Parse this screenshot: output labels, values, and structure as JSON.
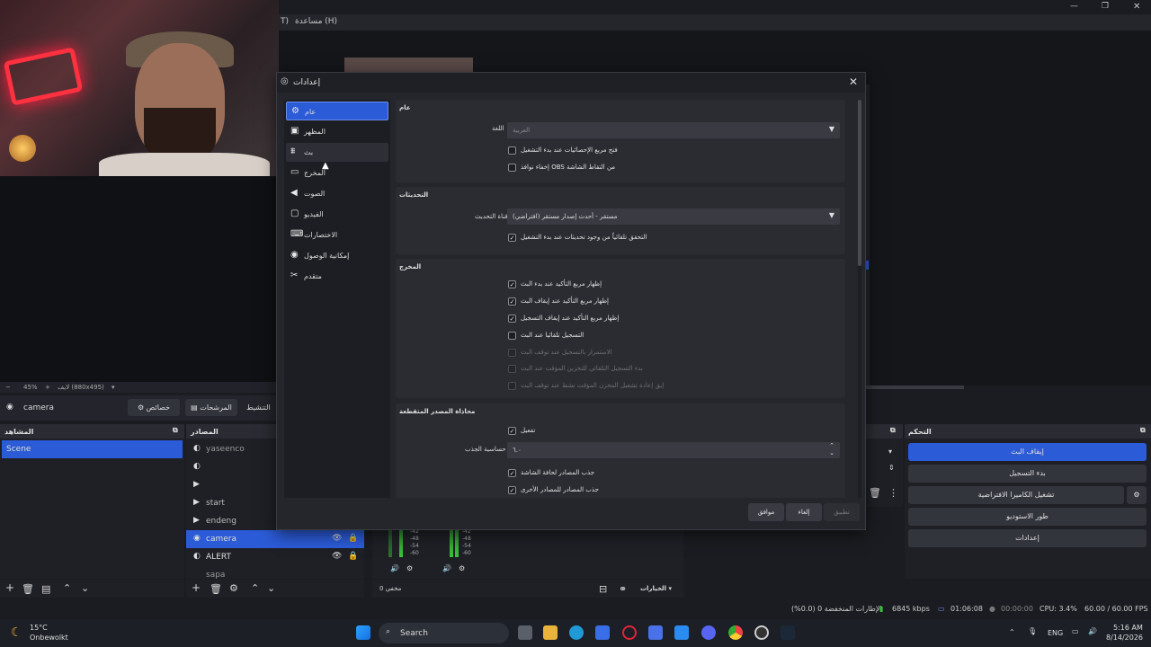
{
  "obs": {
    "menubar": {
      "help": "مساعدة (H)",
      "t": "T)"
    },
    "zoom": {
      "percent": "45%",
      "size": "لايف (880x495)"
    },
    "scene_toolbar": {
      "camera_label": "camera",
      "properties": "خصائص",
      "filters": "المرشحات",
      "activate": "التنشيط"
    },
    "scenes": {
      "title": "المشاهد",
      "items": [
        "Scene"
      ]
    },
    "sources": {
      "title": "المصادر",
      "items": [
        "yaseenco",
        "",
        "",
        "start",
        "endeng",
        "camera",
        "ALERT",
        "sapa"
      ]
    },
    "controls": {
      "title": "التحكم",
      "buttons": [
        "إيقاف البث",
        "بدء التسجيل",
        "تشغيل الكاميرا الافتراضية",
        "طور الاستوديو",
        "إعدادات"
      ]
    },
    "mixer": {
      "ticks": [
        "-42",
        "-48",
        "-54",
        "-60"
      ],
      "muted_label": "مخفي 0",
      "options": "الخيارات"
    },
    "status": {
      "dropped": "الإطارات المنخفضة 0 (0.0%)",
      "kbps": "6845 kbps",
      "stream_time": "01:06:08",
      "rec_time": "00:00:00",
      "cpu": "CPU: 3.4%",
      "fps": "60.00 / 60.00 FPS"
    }
  },
  "taskbar": {
    "weather_temp": "15°C",
    "weather_desc": "Onbewolkt",
    "search_placeholder": "Search",
    "lang": "ENG",
    "time": "5:16 AM",
    "date": "8/14/2026"
  },
  "dialog": {
    "title": "إعدادات",
    "nav": [
      {
        "label": "عام",
        "icon": "gear-icon"
      },
      {
        "label": "المظهر",
        "icon": "appearance-icon"
      },
      {
        "label": "بث",
        "icon": "stream-icon"
      },
      {
        "label": "المخرج",
        "icon": "output-icon"
      },
      {
        "label": "الصوت",
        "icon": "audio-icon"
      },
      {
        "label": "الفيديو",
        "icon": "video-icon"
      },
      {
        "label": "الاختصارات",
        "icon": "keyboard-icon"
      },
      {
        "label": "إمكانية الوصول",
        "icon": "accessibility-icon"
      },
      {
        "label": "متقدم",
        "icon": "tools-icon"
      }
    ],
    "general": {
      "title": "عام",
      "language_label": "اللغة",
      "language_value": "العربية",
      "cb_stats": "فتح مربع الإحصائيات عند بدء التشغيل",
      "cb_hide_obs": "إخفاء نوافذ OBS من التقاط الشاشة"
    },
    "updates": {
      "title": "التحديثات",
      "channel_label": "قناة التحديث",
      "channel_value": "مستقر - أحدث إصدار مستقر (افتراضي)",
      "cb_auto_check": "التحقق تلقائياً من وجود تحديثات عند بدء التشغيل"
    },
    "output": {
      "title": "المخرج",
      "items": [
        {
          "label": "إظهار مربع التأكيد عند بدء البث",
          "checked": true,
          "enabled": true
        },
        {
          "label": "إظهار مربع التأكيد عند إيقاف البث",
          "checked": true,
          "enabled": true
        },
        {
          "label": "إظهار مربع التأكيد عند إيقاف التسجيل",
          "checked": true,
          "enabled": true
        },
        {
          "label": "التسجيل تلقائيا عند البث",
          "checked": false,
          "enabled": true
        },
        {
          "label": "الاستمرار بالتسجيل عند توقف البث",
          "checked": false,
          "enabled": false
        },
        {
          "label": "بدء التسجيل التلقائي للتخزين المؤقت عند البث",
          "checked": false,
          "enabled": false
        },
        {
          "label": "إبق إعادة تشغيل المخزن المؤقت نشط عند توقف البث",
          "checked": false,
          "enabled": false
        }
      ]
    },
    "snapping": {
      "title": "محاذاة المصدر المتقطعة",
      "cb_enable": "تفعيل",
      "sensitivity_label": "حساسية الجذب",
      "sensitivity_value": "٦.٠",
      "cb_screen_edge": "جذب المصادر لحافة الشاشة",
      "cb_other_sources": "جذب المصادر للمصادر الأخرى"
    },
    "buttons": {
      "ok": "موافق",
      "cancel": "إلغاء",
      "apply": "تطبيق"
    }
  }
}
